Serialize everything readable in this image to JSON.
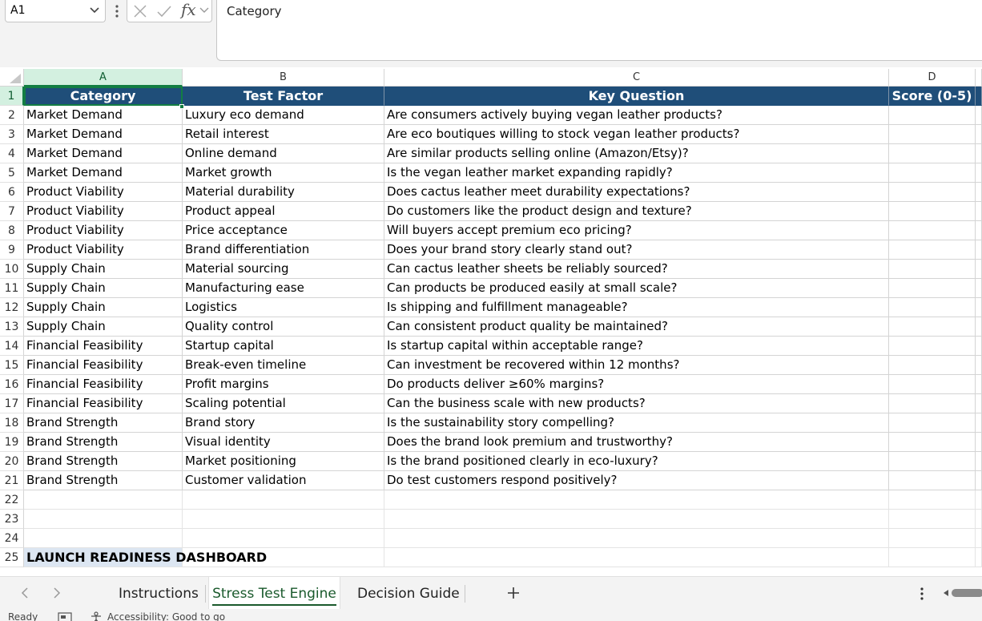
{
  "formula_bar": {
    "name_box": "A1",
    "fx_label": "fx",
    "content": "Category"
  },
  "columns": [
    "A",
    "B",
    "C",
    "D"
  ],
  "header_row": {
    "row": "1",
    "cells": [
      "Category",
      "Test Factor",
      "Key Question",
      "Score (0-5)"
    ]
  },
  "rows": [
    {
      "n": "2",
      "a": "Market Demand",
      "b": "Luxury eco demand",
      "c": "Are consumers actively buying vegan leather products?"
    },
    {
      "n": "3",
      "a": "Market Demand",
      "b": "Retail interest",
      "c": "Are eco boutiques willing to stock vegan leather products?"
    },
    {
      "n": "4",
      "a": "Market Demand",
      "b": "Online demand",
      "c": "Are similar products selling online (Amazon/Etsy)?"
    },
    {
      "n": "5",
      "a": "Market Demand",
      "b": "Market growth",
      "c": "Is the vegan leather market expanding rapidly?"
    },
    {
      "n": "6",
      "a": "Product Viability",
      "b": "Material durability",
      "c": "Does cactus leather meet durability expectations?"
    },
    {
      "n": "7",
      "a": "Product Viability",
      "b": "Product appeal",
      "c": "Do customers like the product design and texture?"
    },
    {
      "n": "8",
      "a": "Product Viability",
      "b": "Price acceptance",
      "c": "Will buyers accept premium eco pricing?"
    },
    {
      "n": "9",
      "a": "Product Viability",
      "b": "Brand differentiation",
      "c": "Does your brand story clearly stand out?"
    },
    {
      "n": "10",
      "a": "Supply Chain",
      "b": "Material sourcing",
      "c": "Can cactus leather sheets be reliably sourced?"
    },
    {
      "n": "11",
      "a": "Supply Chain",
      "b": "Manufacturing ease",
      "c": "Can products be produced easily at small scale?"
    },
    {
      "n": "12",
      "a": "Supply Chain",
      "b": "Logistics",
      "c": "Is shipping and fulfillment manageable?"
    },
    {
      "n": "13",
      "a": "Supply Chain",
      "b": "Quality control",
      "c": "Can consistent product quality be maintained?"
    },
    {
      "n": "14",
      "a": "Financial Feasibility",
      "b": "Startup capital",
      "c": "Is startup capital within acceptable range?"
    },
    {
      "n": "15",
      "a": "Financial Feasibility",
      "b": "Break-even timeline",
      "c": "Can investment be recovered within 12 months?"
    },
    {
      "n": "16",
      "a": "Financial Feasibility",
      "b": "Profit margins",
      "c": "Do products deliver ≥60% margins?"
    },
    {
      "n": "17",
      "a": "Financial Feasibility",
      "b": "Scaling potential",
      "c": "Can the business scale with new products?"
    },
    {
      "n": "18",
      "a": "Brand Strength",
      "b": "Brand story",
      "c": "Is the sustainability story compelling?"
    },
    {
      "n": "19",
      "a": "Brand Strength",
      "b": "Visual identity",
      "c": "Does the brand look premium and trustworthy?"
    },
    {
      "n": "20",
      "a": "Brand Strength",
      "b": "Market positioning",
      "c": "Is the brand positioned clearly in eco-luxury?"
    },
    {
      "n": "21",
      "a": "Brand Strength",
      "b": "Customer validation",
      "c": "Do test customers respond positively?"
    }
  ],
  "empty_rows": [
    "22",
    "23",
    "24"
  ],
  "dashboard_row": {
    "n": "25",
    "title": "LAUNCH READINESS DASHBOARD"
  },
  "sheet_tabs": [
    {
      "label": "Instructions",
      "active": false
    },
    {
      "label": "Stress Test Engine",
      "active": true
    },
    {
      "label": "Decision Guide",
      "active": false
    }
  ],
  "add_sheet_label": "+",
  "status_bar": {
    "ready": "Ready",
    "accessibility": "Accessibility: Good to go"
  },
  "colors": {
    "header_fill": "#1f4e79",
    "selection_green": "#137e43",
    "dashboard_highlight": "#dce6f2"
  }
}
